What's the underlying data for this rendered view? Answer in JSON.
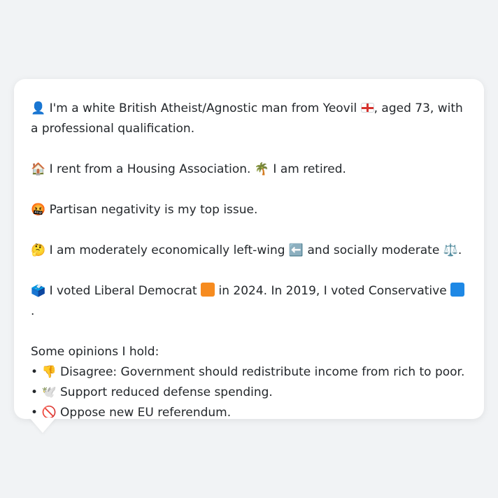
{
  "bio": {
    "icon": "person-icon",
    "text_before_flag": "I'm a white British Atheist/Agnostic man from Yeovil",
    "flag_icon": "england-flag-icon",
    "text_after_flag": ", aged 73, with a professional qualification."
  },
  "housing": {
    "home_icon": "house-icon",
    "home_text": "I rent from a Housing Association.",
    "work_icon": "palm-tree-icon",
    "work_text": "I am retired."
  },
  "top_issue": {
    "icon": "angry-face-icon",
    "text": "Partisan negativity is my top issue."
  },
  "ideology": {
    "icon": "thinking-face-icon",
    "text_before_arrow": "I am moderately economically left-wing",
    "arrow_icon": "left-arrow-icon",
    "text_after_arrow": "and socially moderate",
    "end_icon": "balance-scale-icon",
    "end_punct": "."
  },
  "voting": {
    "icon": "ballot-box-icon",
    "text_2024": "I voted Liberal Democrat",
    "party_2024_color": "#f68b1f",
    "text_mid": "in 2024. In 2019, I voted Conservative",
    "party_2019_color": "#1e88e5",
    "end_punct": "."
  },
  "opinions": {
    "heading": "Some opinions I hold:",
    "items": [
      {
        "bullet": "•",
        "icon": "thumbs-down-icon",
        "text": "Disagree: Government should redistribute income from rich to poor."
      },
      {
        "bullet": "•",
        "icon": "dove-icon",
        "text": "Support reduced defense spending."
      },
      {
        "bullet": "•",
        "icon": "prohibited-icon",
        "text": "Oppose new EU referendum."
      }
    ]
  }
}
